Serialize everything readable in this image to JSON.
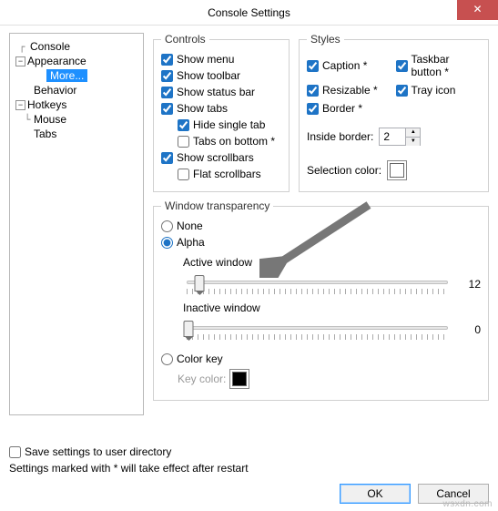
{
  "title": "Console Settings",
  "tree": {
    "console": "Console",
    "appearance": "Appearance",
    "more": "More...",
    "behavior": "Behavior",
    "hotkeys": "Hotkeys",
    "mouse": "Mouse",
    "tabs": "Tabs"
  },
  "controls": {
    "legend": "Controls",
    "show_menu": "Show menu",
    "show_toolbar": "Show toolbar",
    "show_statusbar": "Show status bar",
    "show_tabs": "Show tabs",
    "hide_single_tab": "Hide single tab",
    "tabs_on_bottom": "Tabs on bottom *",
    "show_scrollbars": "Show scrollbars",
    "flat_scrollbars": "Flat scrollbars"
  },
  "styles": {
    "legend": "Styles",
    "caption": "Caption *",
    "taskbar_button": "Taskbar button *",
    "resizable": "Resizable *",
    "tray_icon": "Tray icon",
    "border": "Border *",
    "inside_border_label": "Inside border:",
    "inside_border_value": "2",
    "selection_color_label": "Selection color:",
    "selection_color": "#ffffff"
  },
  "transparency": {
    "legend": "Window transparency",
    "none": "None",
    "alpha": "Alpha",
    "active_label": "Active window",
    "active_value": "12",
    "active_pos_pct": 6,
    "inactive_label": "Inactive window",
    "inactive_value": "0",
    "inactive_pos_pct": 2,
    "color_key": "Color key",
    "key_color_label": "Key color:",
    "key_color": "#000000"
  },
  "footer": {
    "save_cb": "Save settings to user directory",
    "note": "Settings marked with * will take effect after restart",
    "ok": "OK",
    "cancel": "Cancel"
  },
  "watermark": "wsxdn.com"
}
